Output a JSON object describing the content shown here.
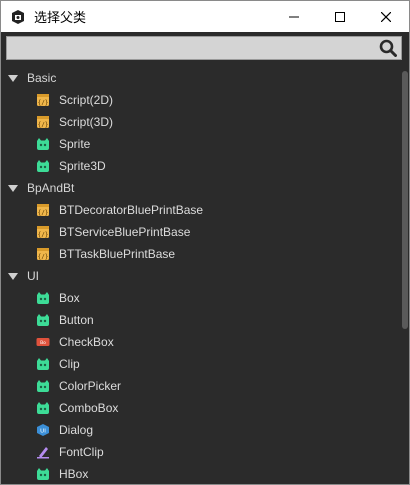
{
  "window": {
    "title": "选择父类",
    "buttons": {
      "minimize": "minimize-icon",
      "maximize": "maximize-icon",
      "close": "close-icon"
    }
  },
  "search": {
    "value": "",
    "placeholder": "",
    "icon": "search-icon"
  },
  "colors": {
    "background": "#2b2b2b",
    "search_bg": "#d4d4d4",
    "script_icon": "#f0b64a",
    "sprite_icon": "#3ddc97",
    "text": "#dcdcdc"
  },
  "groups": [
    {
      "label": "Basic",
      "items": [
        {
          "label": "Script(2D)",
          "icon": "script-icon"
        },
        {
          "label": "Script(3D)",
          "icon": "script-icon"
        },
        {
          "label": "Sprite",
          "icon": "sprite-icon"
        },
        {
          "label": "Sprite3D",
          "icon": "sprite-icon"
        }
      ]
    },
    {
      "label": "BpAndBt",
      "items": [
        {
          "label": "BTDecoratorBluePrintBase",
          "icon": "script-icon"
        },
        {
          "label": "BTServiceBluePrintBase",
          "icon": "script-icon"
        },
        {
          "label": "BTTaskBluePrintBase",
          "icon": "script-icon"
        }
      ]
    },
    {
      "label": "UI",
      "items": [
        {
          "label": "Box",
          "icon": "sprite-icon"
        },
        {
          "label": "Button",
          "icon": "sprite-icon"
        },
        {
          "label": "CheckBox",
          "icon": "checkbox-icon"
        },
        {
          "label": "Clip",
          "icon": "sprite-icon"
        },
        {
          "label": "ColorPicker",
          "icon": "sprite-icon"
        },
        {
          "label": "ComboBox",
          "icon": "sprite-icon"
        },
        {
          "label": "Dialog",
          "icon": "dialog-icon"
        },
        {
          "label": "FontClip",
          "icon": "fontclip-icon"
        },
        {
          "label": "HBox",
          "icon": "sprite-icon"
        }
      ]
    }
  ]
}
